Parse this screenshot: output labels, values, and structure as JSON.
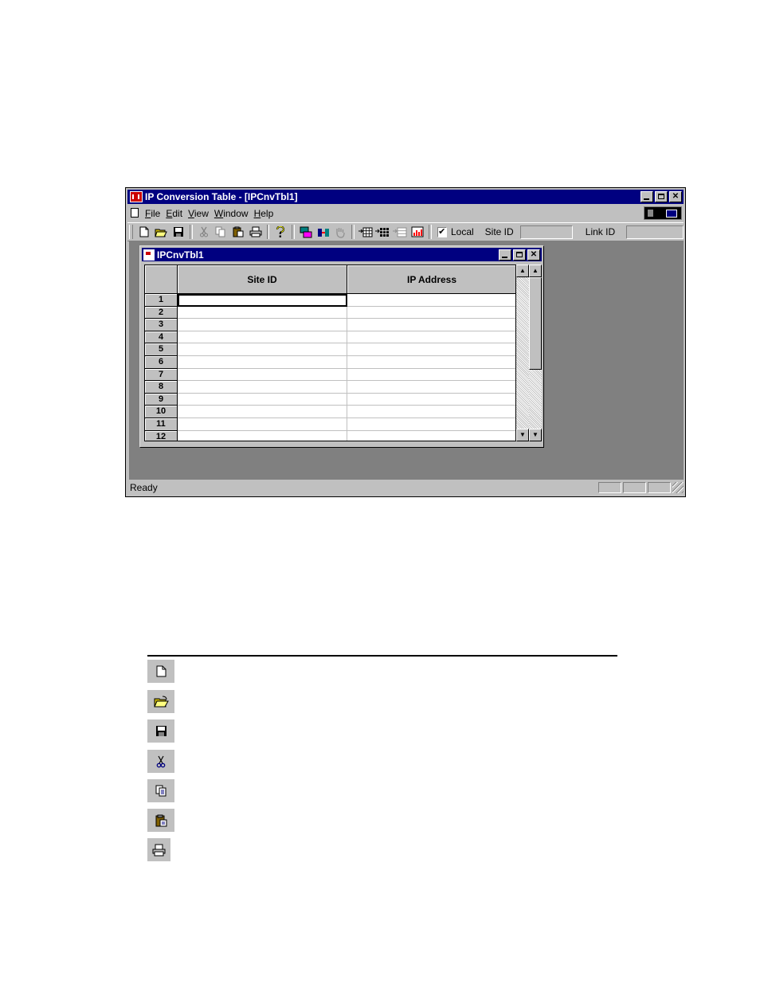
{
  "window": {
    "title": "IP Conversion Table - [IPCnvTbl1]"
  },
  "menu": {
    "items": [
      "File",
      "Edit",
      "View",
      "Window",
      "Help"
    ]
  },
  "toolbar": {
    "local_label": "Local",
    "local_checked": "✔",
    "site_id_label": "Site ID",
    "link_id_label": "Link ID"
  },
  "child": {
    "title": "IPCnvTbl1"
  },
  "grid": {
    "columns": [
      "Site ID",
      "IP Address"
    ],
    "row_numbers": [
      "1",
      "2",
      "3",
      "4",
      "5",
      "6",
      "7",
      "8",
      "9",
      "10",
      "11",
      "12"
    ]
  },
  "status": {
    "text": "Ready"
  },
  "icon_list": [
    "new-file-icon",
    "open-folder-icon",
    "save-disk-icon",
    "cut-scissors-icon",
    "copy-icon",
    "paste-clipboard-icon",
    "print-icon"
  ]
}
